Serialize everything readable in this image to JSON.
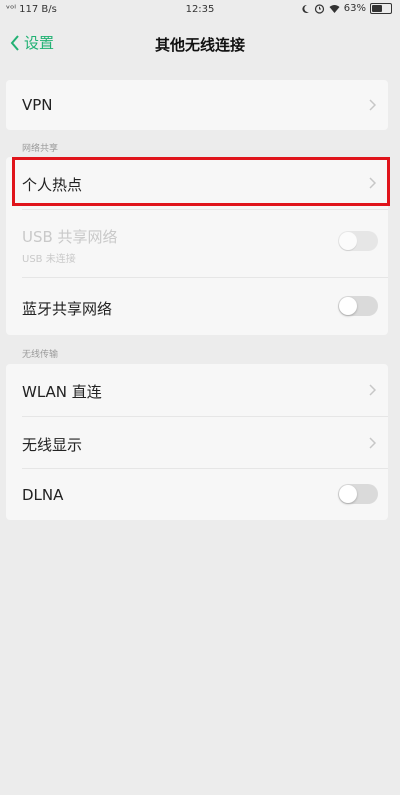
{
  "status": {
    "left": "ᵛᵒˡ 117 B/s",
    "time": "12:35",
    "battery": "63%",
    "battery_level": 0.63
  },
  "nav": {
    "back_label": "设置",
    "title": "其他无线连接"
  },
  "items": {
    "vpn": "VPN",
    "hotspot": "个人热点",
    "usb_tethering": "USB 共享网络",
    "usb_tethering_sub": "USB 未连接",
    "bt_tethering": "蓝牙共享网络",
    "wlan_direct": "WLAN 直连",
    "wireless_display": "无线显示",
    "dlna": "DLNA"
  },
  "sections": {
    "network_sharing": "网络共享",
    "wireless_transfer": "无线传输"
  },
  "toggles": {
    "usb_tethering": false,
    "bt_tethering": false,
    "dlna": false
  },
  "colors": {
    "accent": "#21b173",
    "highlight": "#e0141b"
  }
}
